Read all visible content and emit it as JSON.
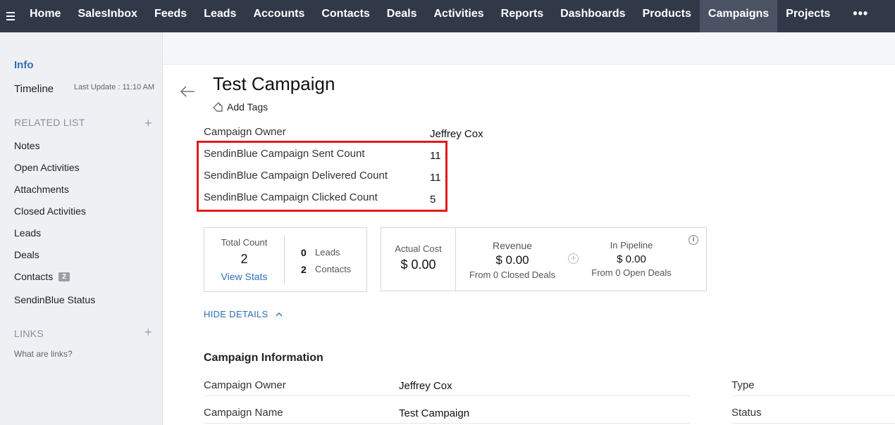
{
  "nav": {
    "items": [
      "Home",
      "SalesInbox",
      "Feeds",
      "Leads",
      "Accounts",
      "Contacts",
      "Deals",
      "Activities",
      "Reports",
      "Dashboards",
      "Products",
      "Campaigns",
      "Projects"
    ],
    "active": "Campaigns",
    "more_label": "•••"
  },
  "sidebar": {
    "info": "Info",
    "timeline": "Timeline",
    "last_update": "Last Update : 11:10 AM",
    "related_list_heading": "RELATED LIST",
    "related_items": [
      "Notes",
      "Open Activities",
      "Attachments",
      "Closed Activities",
      "Leads",
      "Deals",
      "Contacts",
      "SendinBlue Status"
    ],
    "contacts_badge": "2",
    "links_heading": "LINKS",
    "links_help": "What are links?"
  },
  "record": {
    "title": "Test Campaign",
    "add_tags": "Add Tags",
    "fields": [
      {
        "label": "Campaign Owner",
        "value": "Jeffrey Cox"
      },
      {
        "label": "SendinBlue Campaign Sent Count",
        "value": "11"
      },
      {
        "label": "SendinBlue Campaign Delivered Count",
        "value": "11"
      },
      {
        "label": "SendinBlue Campaign Clicked Count",
        "value": "5"
      }
    ]
  },
  "stats": {
    "total_count_label": "Total Count",
    "total_count": "2",
    "view_stats": "View Stats",
    "leads_count": "0",
    "leads_label": "Leads",
    "contacts_count": "2",
    "contacts_label": "Contacts",
    "actual_cost_label": "Actual Cost",
    "actual_cost": "$ 0.00",
    "revenue_label": "Revenue",
    "revenue": "$ 0.00",
    "revenue_sub": "From 0 Closed Deals",
    "pipeline_label": "In Pipeline",
    "pipeline": "$ 0.00",
    "pipeline_sub": "From 0 Open Deals"
  },
  "hide_details": "HIDE DETAILS",
  "campaign_info": {
    "title": "Campaign Information",
    "rows": [
      {
        "label": "Campaign Owner",
        "value": "Jeffrey Cox"
      },
      {
        "label": "Campaign Name",
        "value": "Test Campaign"
      }
    ],
    "right_labels": [
      "Type",
      "Status"
    ]
  }
}
